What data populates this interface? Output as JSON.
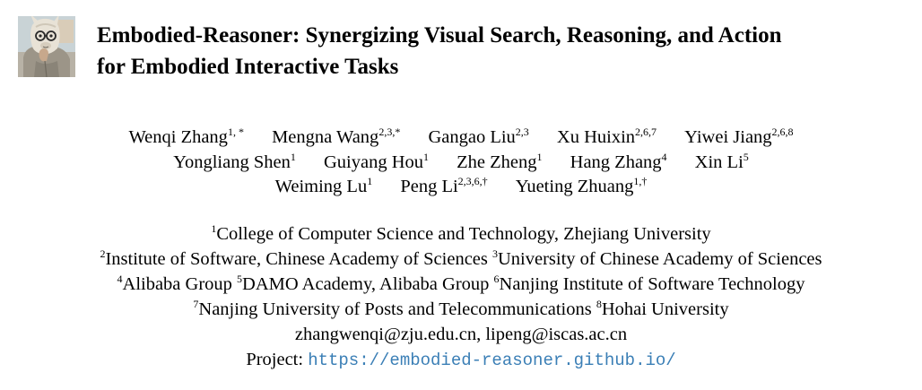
{
  "title": {
    "line1": "Embodied-Reasoner: Synergizing Visual Search, Reasoning, and Action",
    "line2": "for Embodied Interactive Tasks"
  },
  "logo": {
    "icon": "alpaca-thinking-logo",
    "colors": {
      "sky": "#c9d3d6",
      "wool": "#e8e2d6",
      "shadow": "#8a8478",
      "glasses": "#2a2a2a",
      "hand": "#c7a88c"
    }
  },
  "authors": {
    "line1": [
      {
        "name": "Wenqi Zhang",
        "sup": "1, *"
      },
      {
        "name": "Mengna Wang",
        "sup": "2,3,*"
      },
      {
        "name": "Gangao Liu",
        "sup": "2,3"
      },
      {
        "name": "Xu Huixin",
        "sup": "2,6,7"
      },
      {
        "name": "Yiwei Jiang",
        "sup": "2,6,8"
      }
    ],
    "line2": [
      {
        "name": "Yongliang Shen",
        "sup": "1"
      },
      {
        "name": "Guiyang Hou",
        "sup": "1"
      },
      {
        "name": "Zhe Zheng",
        "sup": "1"
      },
      {
        "name": "Hang Zhang",
        "sup": "4"
      },
      {
        "name": "Xin Li",
        "sup": "5"
      }
    ],
    "line3": [
      {
        "name": "Weiming Lu",
        "sup": "1"
      },
      {
        "name": "Peng Li",
        "sup": "2,3,6,†"
      },
      {
        "name": "Yueting Zhuang",
        "sup": "1,†"
      }
    ]
  },
  "affiliations": {
    "a1": {
      "sup": "1",
      "text": "College of Computer Science and Technology, Zhejiang University"
    },
    "a2": {
      "sup": "2",
      "text": "Institute of Software, Chinese Academy of Sciences "
    },
    "a3": {
      "sup": "3",
      "text": "University of Chinese Academy of Sciences"
    },
    "a4": {
      "sup": "4",
      "text": "Alibaba Group "
    },
    "a5": {
      "sup": "5",
      "text": "DAMO Academy, Alibaba Group "
    },
    "a6": {
      "sup": "6",
      "text": "Nanjing Institute of Software Technology"
    },
    "a7": {
      "sup": "7",
      "text": "Nanjing University of Posts and Telecommunications "
    },
    "a8": {
      "sup": "8",
      "text": "Hohai University"
    }
  },
  "emails": "zhangwenqi@zju.edu.cn, lipeng@iscas.ac.cn",
  "project": {
    "label": "Project: ",
    "url": "https://embodied-reasoner.github.io/",
    "link_color": "#3b7fb6"
  }
}
